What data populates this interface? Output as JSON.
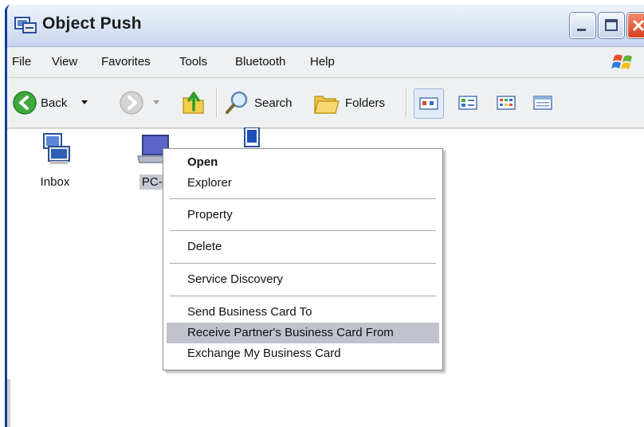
{
  "window": {
    "title": "Object Push"
  },
  "menubar": {
    "items": [
      "File",
      "View",
      "Favorites",
      "Tools",
      "Bluetooth",
      "Help"
    ]
  },
  "toolbar": {
    "back_label": "Back",
    "search_label": "Search",
    "folders_label": "Folders",
    "views": [
      "tiles-view-icon",
      "icons-view-icon",
      "list-view-icon",
      "details-view-icon"
    ]
  },
  "content": {
    "items": [
      {
        "label": "Inbox",
        "icon": "inbox-icon",
        "selected": false
      },
      {
        "label": "PC-1",
        "icon": "laptop-icon",
        "selected": true
      },
      {
        "label": "",
        "icon": "device-icon",
        "selected": false
      }
    ]
  },
  "context_menu": {
    "groups": [
      [
        "Open",
        "Explorer"
      ],
      [
        "Property"
      ],
      [
        "Delete"
      ],
      [
        "Service Discovery"
      ],
      [
        "Send Business Card To",
        "Receive Partner's Business Card From",
        "Exchange My Business Card"
      ]
    ],
    "default_item": "Open",
    "highlighted_item": "Receive Partner's Business Card From"
  },
  "colors": {
    "titlebar_gradient_top": "#eef3fb",
    "titlebar_border": "#0a3f9c",
    "close_button": "#d6401f",
    "menu_highlight": "#c0c2cd",
    "selection": "#c7c9d2"
  }
}
